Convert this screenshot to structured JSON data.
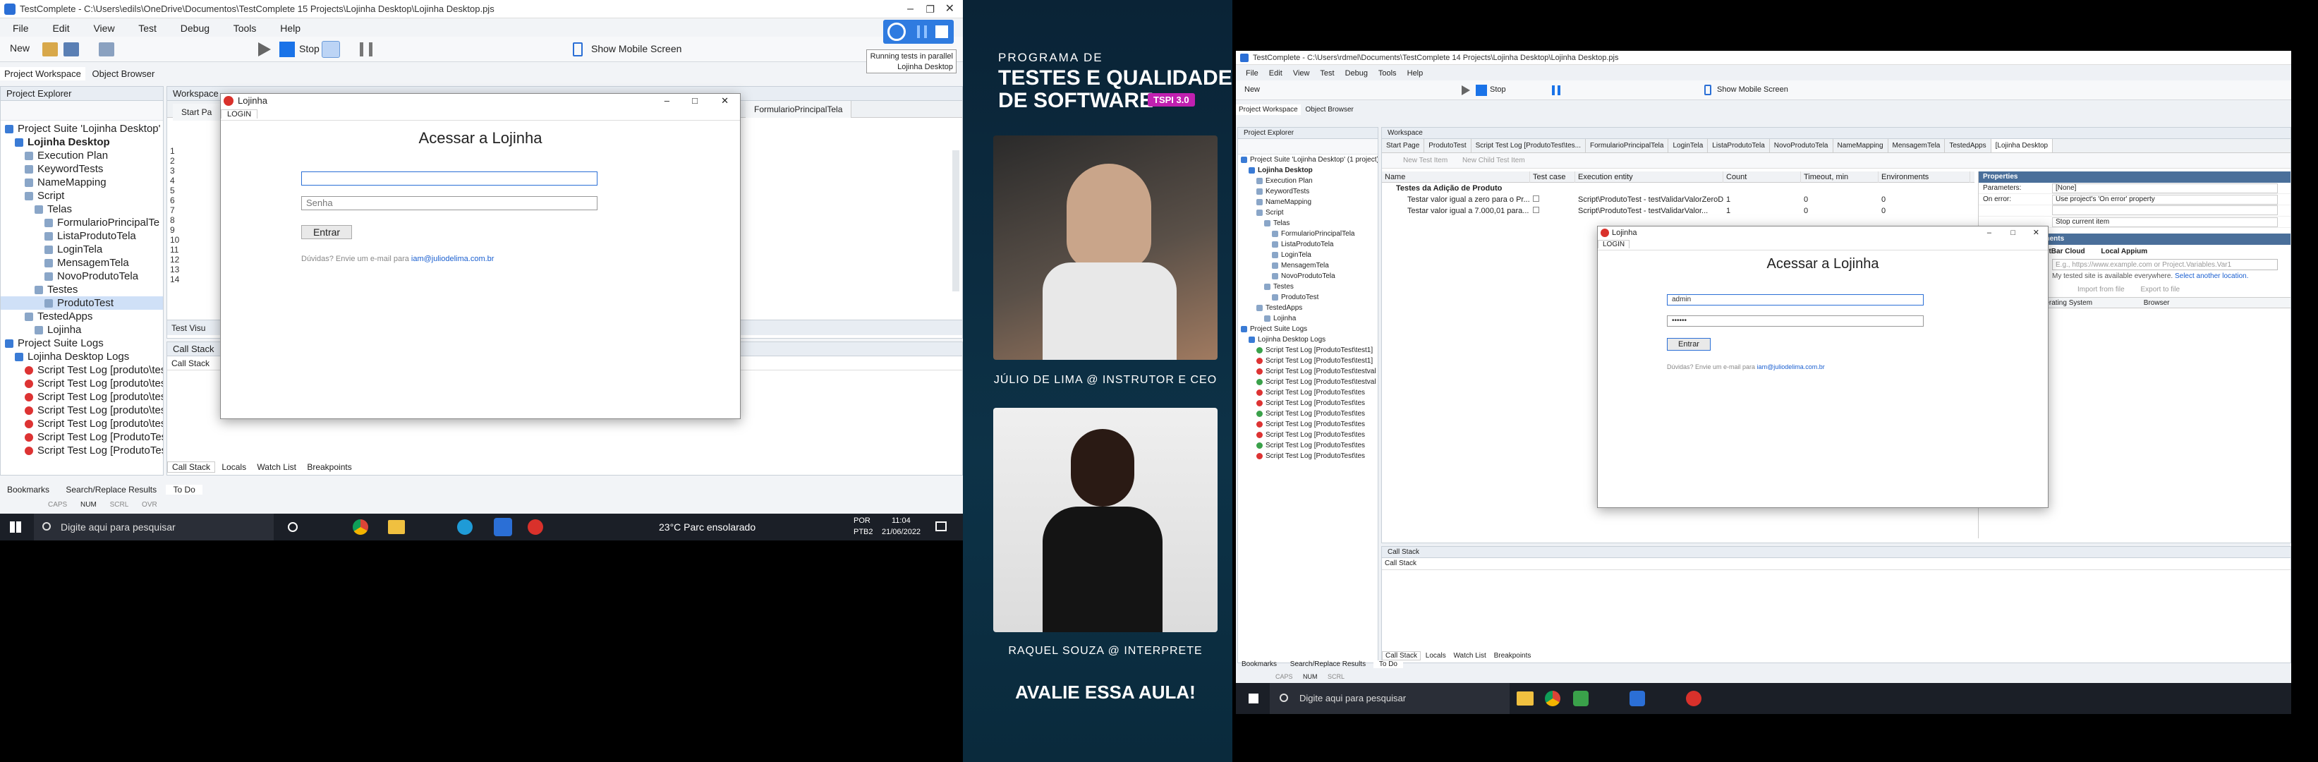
{
  "left": {
    "window_title": "TestComplete - C:\\Users\\edils\\OneDrive\\Documentos\\TestComplete 15 Projects\\Lojinha Desktop\\Lojinha Desktop.pjs",
    "menu": [
      "File",
      "Edit",
      "View",
      "Test",
      "Debug",
      "Tools",
      "Help"
    ],
    "toolbar": {
      "new_label": "New",
      "stop_label": "Stop",
      "mobile_label": "Show Mobile Screen"
    },
    "parallel_tooltip": {
      "line1": "Running tests in parallel",
      "line2": "Lojinha Desktop"
    },
    "workspace_tabs": [
      "Project Workspace",
      "Object Browser"
    ],
    "explorer_title": "Project Explorer",
    "workspace_title": "Workspace",
    "doc_tabs": [
      "Start Pa",
      "FormularioPrincipalTela"
    ],
    "tree": [
      {
        "label": "Project Suite 'Lojinha Desktop' (1 pro",
        "lvl": 0
      },
      {
        "label": "Lojinha Desktop",
        "lvl": 1,
        "bold": true
      },
      {
        "label": "Execution Plan",
        "lvl": 2
      },
      {
        "label": "KeywordTests",
        "lvl": 2
      },
      {
        "label": "NameMapping",
        "lvl": 2
      },
      {
        "label": "Script",
        "lvl": 2
      },
      {
        "label": "Telas",
        "lvl": 3
      },
      {
        "label": "FormularioPrincipalTe",
        "lvl": 4
      },
      {
        "label": "ListaProdutoTela",
        "lvl": 4
      },
      {
        "label": "LoginTela",
        "lvl": 4
      },
      {
        "label": "MensagemTela",
        "lvl": 4
      },
      {
        "label": "NovoProdutoTela",
        "lvl": 4
      },
      {
        "label": "Testes",
        "lvl": 3
      },
      {
        "label": "ProdutoTest",
        "lvl": 4,
        "selected": true
      },
      {
        "label": "TestedApps",
        "lvl": 2
      },
      {
        "label": "Lojinha",
        "lvl": 3
      },
      {
        "label": "Project Suite Logs",
        "lvl": 0
      },
      {
        "label": "Lojinha Desktop Logs",
        "lvl": 1
      },
      {
        "label": "Script Test Log [produto\\test",
        "lvl": 2
      },
      {
        "label": "Script Test Log [produto\\test",
        "lvl": 2
      },
      {
        "label": "Script Test Log [produto\\test",
        "lvl": 2
      },
      {
        "label": "Script Test Log [produto\\test",
        "lvl": 2
      },
      {
        "label": "Script Test Log [produto\\test",
        "lvl": 2
      },
      {
        "label": "Script Test Log [ProdutoTest",
        "lvl": 2
      },
      {
        "label": "Script Test Log [ProdutoTest",
        "lvl": 2
      }
    ],
    "line_numbers": [
      "1",
      "2",
      "3",
      "4",
      "5",
      "6",
      "7",
      "8",
      "9",
      "10",
      "11",
      "12",
      "13",
      "14"
    ],
    "test_visual_label": "Test Visu",
    "call_stack_title": "Call Stack",
    "call_stack_col": "Call Stack",
    "bottom_tabs": [
      "Call Stack",
      "Locals",
      "Watch List",
      "Breakpoints"
    ],
    "status_tabs": [
      "Bookmarks",
      "Search/Replace Results",
      "To Do"
    ],
    "status_indicators": [
      "CAPS",
      "NUM",
      "SCRL",
      "OVR"
    ],
    "dialog": {
      "title": "Lojinha",
      "tab": "LOGIN",
      "heading": "Acessar a Lojinha",
      "username_placeholder": "",
      "password_placeholder": "Senha",
      "button": "Entrar",
      "help_text": "Dúvidas? Envie um e-mail para ",
      "help_email": "iam@juliodelima.com.br"
    },
    "taskbar": {
      "search_placeholder": "Digite aqui para pesquisar",
      "weather": "23°C  Parc ensolarado",
      "lang1": "POR",
      "lang2": "PTB2",
      "time": "11:04",
      "date": "21/06/2022"
    }
  },
  "promo": {
    "kicker": "PROGRAMA DE",
    "title1": "TESTES E QUALIDADE",
    "title2": "DE SOFTWARE",
    "badge": "TSPI 3.0",
    "instructor": "JÚLIO DE LIMA @ INSTRUTOR E CEO",
    "interpreter": "RAQUEL SOUZA @ INTERPRETE",
    "cta": "AVALIE ESSA AULA!"
  },
  "right": {
    "window_title": "TestComplete - C:\\Users\\rdmel\\Documents\\TestComplete 14 Projects\\Lojinha Desktop\\Lojinha Desktop.pjs",
    "menu": [
      "File",
      "Edit",
      "View",
      "Test",
      "Debug",
      "Tools",
      "Help"
    ],
    "toolbar": {
      "new_label": "New",
      "stop_label": "Stop",
      "mobile_label": "Show Mobile Screen"
    },
    "workspace_tabs": [
      "Project Workspace",
      "Object Browser"
    ],
    "explorer_title": "Project Explorer",
    "workspace_title": "Workspace",
    "doc_tabs": [
      "Start Page",
      "ProdutoTest",
      "Script Test Log [ProdutoTest\\tes...",
      "FormularioPrincipalTela",
      "LoginTela",
      "ListaProdutoTela",
      "NovoProdutoTela",
      "NameMapping",
      "MensagemTela",
      "TestedApps",
      "[Lojinha Desktop"
    ],
    "tree": [
      {
        "label": "Project Suite 'Lojinha Desktop' (1 project)",
        "lvl": 0
      },
      {
        "label": "Lojinha Desktop",
        "lvl": 1,
        "bold": true
      },
      {
        "label": "Execution Plan",
        "lvl": 2
      },
      {
        "label": "KeywordTests",
        "lvl": 2
      },
      {
        "label": "NameMapping",
        "lvl": 2
      },
      {
        "label": "Script",
        "lvl": 2
      },
      {
        "label": "Telas",
        "lvl": 3
      },
      {
        "label": "FormularioPrincipalTela",
        "lvl": 4
      },
      {
        "label": "ListaProdutoTela",
        "lvl": 4
      },
      {
        "label": "LoginTela",
        "lvl": 4
      },
      {
        "label": "MensagemTela",
        "lvl": 4
      },
      {
        "label": "NovoProdutoTela",
        "lvl": 4
      },
      {
        "label": "Testes",
        "lvl": 3
      },
      {
        "label": "ProdutoTest",
        "lvl": 4
      },
      {
        "label": "TestedApps",
        "lvl": 2
      },
      {
        "label": "Lojinha",
        "lvl": 3
      },
      {
        "label": "Project Suite Logs",
        "lvl": 0
      },
      {
        "label": "Lojinha Desktop Logs",
        "lvl": 1
      },
      {
        "label": "Script Test Log [ProdutoTest\\test1]",
        "lvl": 2
      },
      {
        "label": "Script Test Log [ProdutoTest\\test1]",
        "lvl": 2
      },
      {
        "label": "Script Test Log [ProdutoTest\\testval",
        "lvl": 2
      },
      {
        "label": "Script Test Log [ProdutoTest\\testval",
        "lvl": 2
      },
      {
        "label": "Script Test Log [ProdutoTest\\tes",
        "lvl": 2
      },
      {
        "label": "Script Test Log [ProdutoTest\\tes",
        "lvl": 2
      },
      {
        "label": "Script Test Log [ProdutoTest\\tes",
        "lvl": 2
      },
      {
        "label": "Script Test Log [ProdutoTest\\tes",
        "lvl": 2
      },
      {
        "label": "Script Test Log [ProdutoTest\\tes",
        "lvl": 2
      },
      {
        "label": "Script Test Log [ProdutoTest\\tes",
        "lvl": 2
      },
      {
        "label": "Script Test Log [ProdutoTest\\tes",
        "lvl": 2
      }
    ],
    "sub_toolbar": [
      "New Test Item",
      "New Child Test Item"
    ],
    "grid_headers": [
      "Name",
      "Test case",
      "Execution entity",
      "Count",
      "Timeout, min",
      "Environments"
    ],
    "grid_rows": [
      {
        "name": "Testes da Adição de Produto",
        "entity": "",
        "count": "",
        "timeout": "",
        "env": ""
      },
      {
        "name": "Testar valor igual a zero para o Pr...",
        "entity": "Script\\ProdutoTest - testValidarValorZeroDoProduto",
        "count": "1",
        "timeout": "0",
        "env": "0"
      },
      {
        "name": "Testar valor igual a 7.000,01 para...",
        "entity": "Script\\ProdutoTest - testValidarValor...",
        "count": "1",
        "timeout": "0",
        "env": "0"
      }
    ],
    "properties_title": "Properties",
    "properties": [
      {
        "label": "Parameters:",
        "value": "[None]"
      },
      {
        "label": "On error:",
        "value": "Use project's 'On error' property"
      },
      {
        "label": "",
        "value": ""
      },
      {
        "label": "",
        "value": "Stop current item"
      }
    ],
    "env_title": "ed Environments",
    "env_options": [
      "esting",
      "BitBar Cloud",
      "Local Appium"
    ],
    "env_url_placeholder": "E.g., https://www.example.com or Project.Variables.Var1",
    "env_note": "My tested site is available everywhere.",
    "env_link": "Select another location.",
    "env_actions": [
      "Import from file",
      "Export to file"
    ],
    "env_cols": [
      "Operating System",
      "Browser"
    ],
    "call_stack_title": "Call Stack",
    "call_stack_col": "Call Stack",
    "bottom_tabs": [
      "Call Stack",
      "Locals",
      "Watch List",
      "Breakpoints"
    ],
    "status_tabs": [
      "Bookmarks",
      "Search/Replace Results",
      "To Do"
    ],
    "status_indicators": [
      "CAPS",
      "NUM",
      "SCRL"
    ],
    "dialog": {
      "title": "Lojinha",
      "tab": "LOGIN",
      "heading": "Acessar a Lojinha",
      "username_value": "admin",
      "password_value": "••••••",
      "button": "Entrar",
      "help_text": "Dúvidas? Envie um e-mail para ",
      "help_email": "iam@juliodelima.com.br"
    },
    "taskbar": {
      "search_placeholder": "Digite aqui para pesquisar"
    }
  }
}
